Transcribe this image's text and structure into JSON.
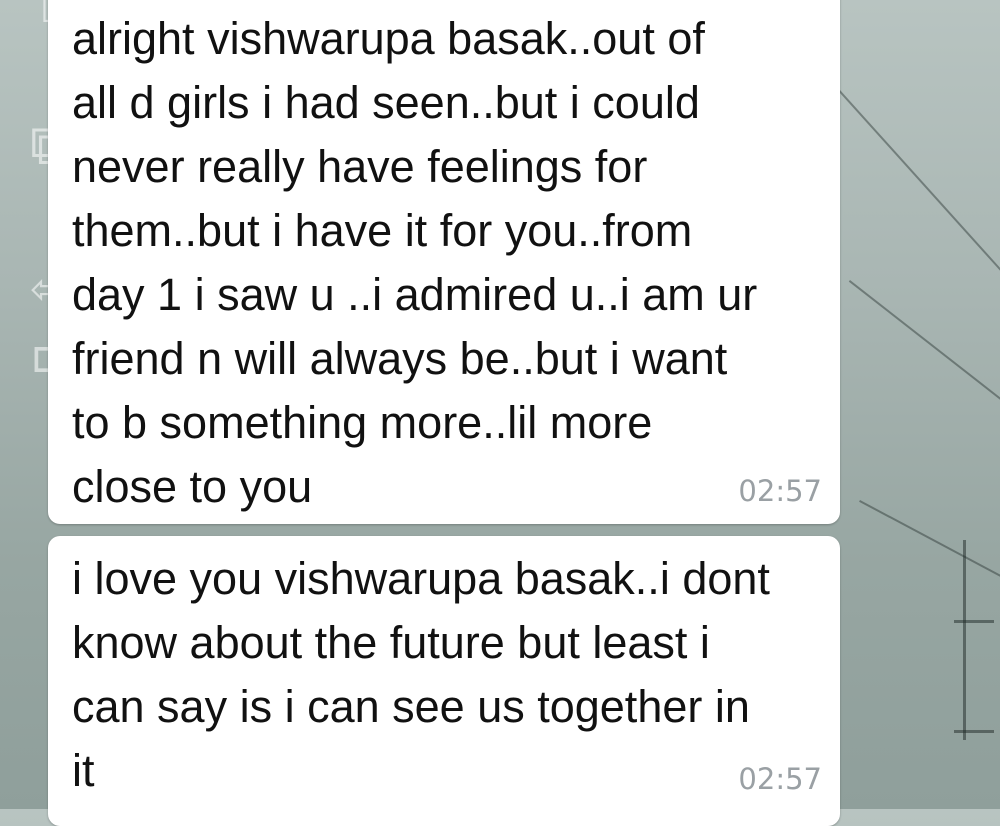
{
  "conversation": {
    "messages": [
      {
        "text": "alright vishwarupa basak..out of\nall d girls i had seen..but i could\nnever really have feelings for\nthem..but i have it for you..from\nday 1 i saw u ..i admired u..i am ur\nfriend n will always be..but i want\nto b something more..lil more\nclose to you",
        "time": "02:57"
      },
      {
        "text": "i love you vishwarupa basak..i dont\nknow about the future but least i\ncan say is i can see us together in\nit",
        "time": "02:57"
      }
    ]
  },
  "colors": {
    "bubble": "#ffffff",
    "text": "#111111",
    "timestamp": "#9aa0a4"
  },
  "icons": {
    "side": [
      "reply-arrow-icon",
      "forward-icon",
      "back-arrow-icon",
      "bracket-icon"
    ]
  }
}
